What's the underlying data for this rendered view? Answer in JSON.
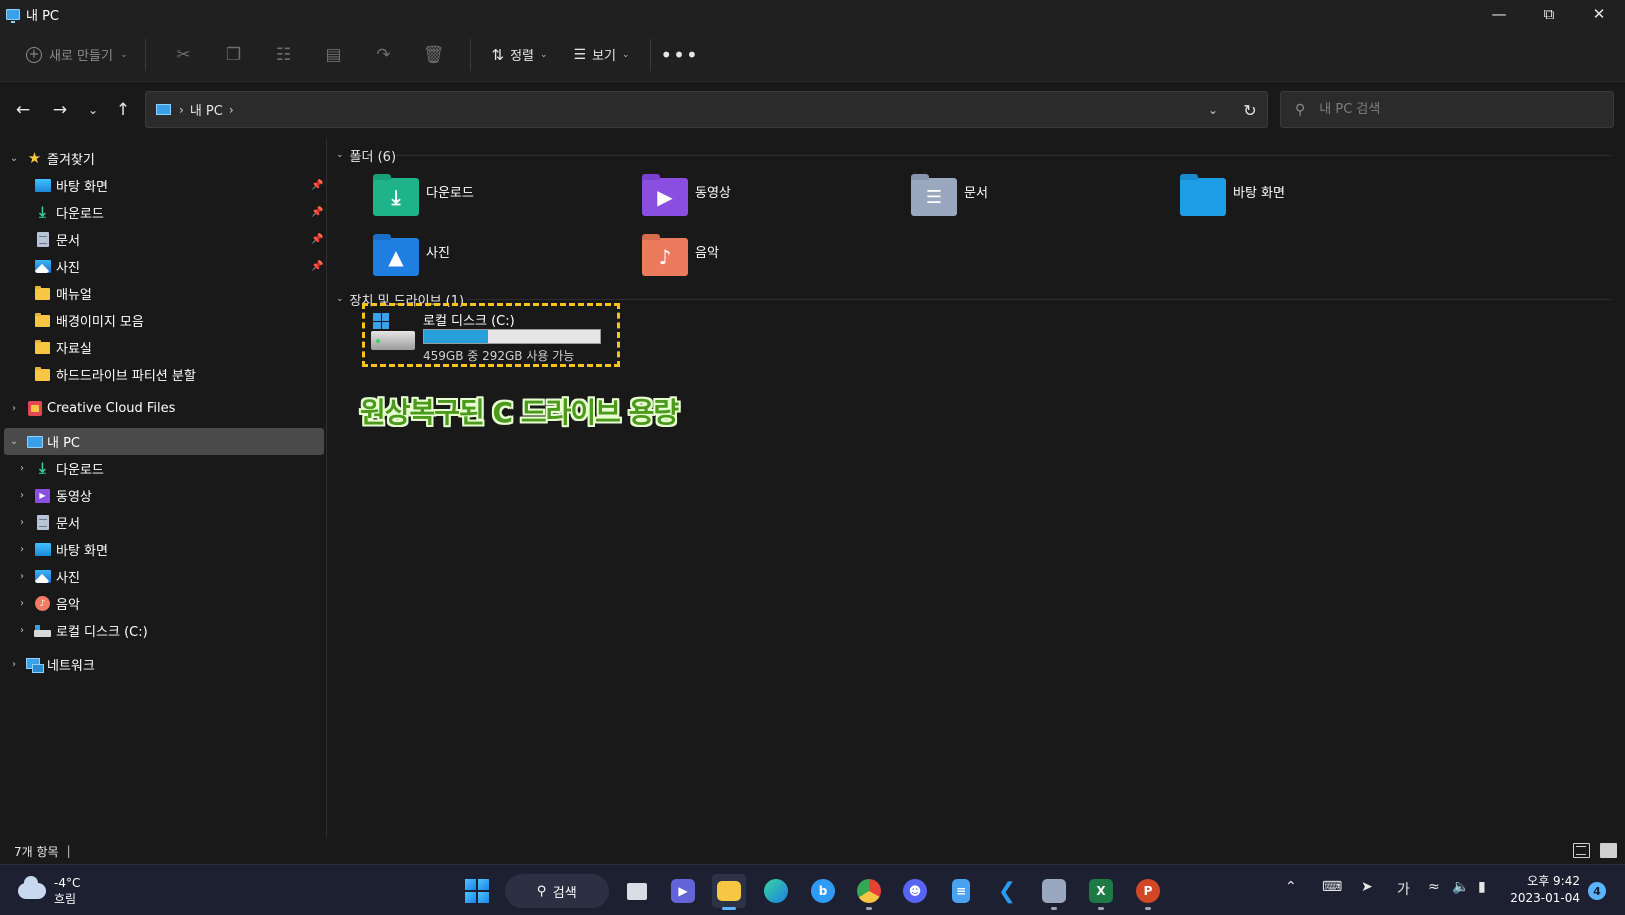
{
  "window": {
    "title": "내 PC"
  },
  "toolbar": {
    "new_label": "새로 만들기",
    "sort_label": "정렬",
    "view_label": "보기"
  },
  "address": {
    "crumbs": [
      "내 PC"
    ]
  },
  "search": {
    "placeholder": "내 PC 검색"
  },
  "sidebar": {
    "favorites_label": "즐겨찾기",
    "favorites": [
      {
        "label": "바탕 화면",
        "icon": "desktop-icon",
        "pinned": true
      },
      {
        "label": "다운로드",
        "icon": "download-icon",
        "pinned": true
      },
      {
        "label": "문서",
        "icon": "document-icon",
        "pinned": true
      },
      {
        "label": "사진",
        "icon": "picture-icon",
        "pinned": true
      },
      {
        "label": "매뉴얼",
        "icon": "folder-icon",
        "pinned": false
      },
      {
        "label": "배경이미지 모음",
        "icon": "folder-icon",
        "pinned": false
      },
      {
        "label": "자료실",
        "icon": "folder-icon",
        "pinned": false
      },
      {
        "label": "하드드라이브 파티션 분할",
        "icon": "folder-icon",
        "pinned": false
      }
    ],
    "creative_cloud_label": "Creative Cloud Files",
    "this_pc_label": "내 PC",
    "this_pc_children": [
      {
        "label": "다운로드",
        "icon": "download-icon"
      },
      {
        "label": "동영상",
        "icon": "video-icon"
      },
      {
        "label": "문서",
        "icon": "document-icon"
      },
      {
        "label": "바탕 화면",
        "icon": "desktop-icon"
      },
      {
        "label": "사진",
        "icon": "picture-icon"
      },
      {
        "label": "음악",
        "icon": "music-icon"
      },
      {
        "label": "로컬 디스크 (C:)",
        "icon": "drive-icon"
      }
    ],
    "network_label": "네트워크"
  },
  "main": {
    "folders_header": "폴더 (6)",
    "folders": [
      {
        "label": "다운로드",
        "icon": "download-folder-icon",
        "color": "#1fb38a"
      },
      {
        "label": "동영상",
        "icon": "video-folder-icon",
        "color": "#8a4fe0"
      },
      {
        "label": "문서",
        "icon": "document-folder-icon",
        "color": "#9aa8bf"
      },
      {
        "label": "바탕 화면",
        "icon": "desktop-folder-icon",
        "color": "#1f9ee8"
      },
      {
        "label": "사진",
        "icon": "picture-folder-icon",
        "color": "#1f7fe0"
      },
      {
        "label": "음악",
        "icon": "music-folder-icon",
        "color": "#ec7a5c"
      }
    ],
    "drives_header": "장치 및 드라이브 (1)",
    "drive": {
      "name": "로컬 디스크 (C:)",
      "info": "459GB 중 292GB 사용 가능",
      "used_fraction": 0.364
    },
    "annotation": "원상복구된 C 드라이브 용량"
  },
  "status": {
    "item_count": "7개 항목"
  },
  "taskbar": {
    "weather_temp": "-4°C",
    "weather_desc": "흐림",
    "search_label": "검색",
    "ime_label": "가",
    "time": "오후 9:42",
    "date": "2023-01-04",
    "notifications": "4"
  },
  "colors": {
    "accent": "#26a0da",
    "highlight_border": "#f7c31c",
    "annotation_text": "#4b9a1e"
  }
}
